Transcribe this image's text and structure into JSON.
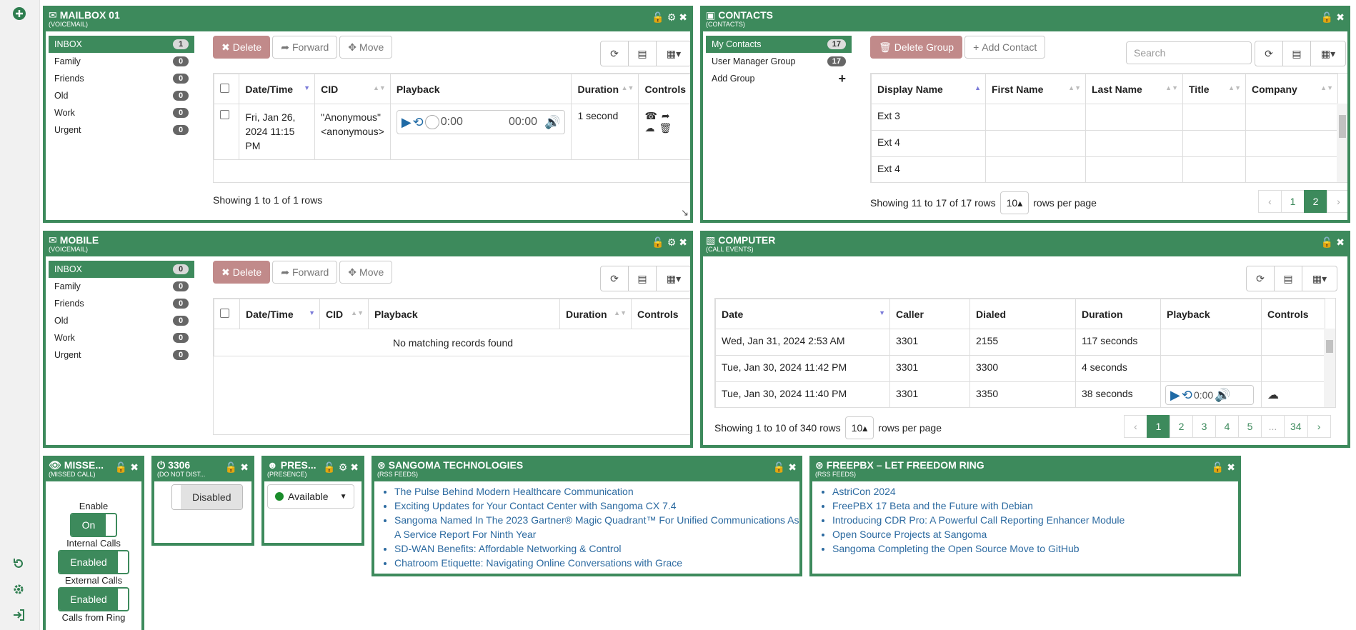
{
  "colors": {
    "accent": "#3d8a5c",
    "danger_btn": "#c18a8a",
    "link": "#2c6aa0"
  },
  "sidebar": {
    "top_icon": "plus-circle-icon",
    "bottom_icons": [
      "refresh-icon",
      "gear-icon",
      "sign-out-icon"
    ]
  },
  "mailbox": {
    "title": "MAILBOX 01",
    "subtitle": "(VOICEMAIL)",
    "folders": [
      {
        "label": "INBOX",
        "count": "1"
      },
      {
        "label": "Family",
        "count": "0"
      },
      {
        "label": "Friends",
        "count": "0"
      },
      {
        "label": "Old",
        "count": "0"
      },
      {
        "label": "Work",
        "count": "0"
      },
      {
        "label": "Urgent",
        "count": "0"
      }
    ],
    "buttons": {
      "delete": "Delete",
      "forward": "Forward",
      "move": "Move"
    },
    "columns": [
      "Date/Time",
      "CID",
      "Playback",
      "Duration",
      "Controls"
    ],
    "row": {
      "datetime": "Fri, Jan 26, 2024 11:15 PM",
      "cid_name": "\"Anonymous\"",
      "cid_num": "<anonymous>",
      "time_start": "0:00",
      "time_end": "00:00",
      "duration": "1 second"
    },
    "footer": "Showing 1 to 1 of 1 rows"
  },
  "mobile": {
    "title": "MOBILE",
    "subtitle": "(VOICEMAIL)",
    "folders": [
      {
        "label": "INBOX",
        "count": "0"
      },
      {
        "label": "Family",
        "count": "0"
      },
      {
        "label": "Friends",
        "count": "0"
      },
      {
        "label": "Old",
        "count": "0"
      },
      {
        "label": "Work",
        "count": "0"
      },
      {
        "label": "Urgent",
        "count": "0"
      }
    ],
    "buttons": {
      "delete": "Delete",
      "forward": "Forward",
      "move": "Move"
    },
    "columns": [
      "Date/Time",
      "CID",
      "Playback",
      "Duration",
      "Controls"
    ],
    "empty": "No matching records found"
  },
  "contacts": {
    "title": "CONTACTS",
    "subtitle": "(CONTACTS)",
    "groups": [
      {
        "label": "My Contacts",
        "count": "17"
      },
      {
        "label": "User Manager Group",
        "count": "17"
      }
    ],
    "add_group": "Add Group",
    "buttons": {
      "delete_group": "Delete Group",
      "add_contact": "Add Contact"
    },
    "search_placeholder": "Search",
    "columns": [
      "Display Name",
      "First Name",
      "Last Name",
      "Title",
      "Company"
    ],
    "rows": [
      "Ext 3",
      "Ext 4",
      "Ext 4"
    ],
    "footer": "Showing 11 to 17 of 17 rows",
    "rows_per_page": "10",
    "rows_per_page_label": "rows per page",
    "pages": [
      "‹",
      "1",
      "2",
      "›"
    ]
  },
  "computer": {
    "title": "COMPUTER",
    "subtitle": "(CALL EVENTS)",
    "columns": [
      "Date",
      "Caller",
      "Dialed",
      "Duration",
      "Playback",
      "Controls"
    ],
    "rows": [
      {
        "date": "Wed, Jan 31, 2024 2:53 AM",
        "caller": "3301",
        "dialed": "2155",
        "duration": "117 seconds"
      },
      {
        "date": "Tue, Jan 30, 2024 11:42 PM",
        "caller": "3301",
        "dialed": "3300",
        "duration": "4 seconds"
      },
      {
        "date": "Tue, Jan 30, 2024 11:40 PM",
        "caller": "3301",
        "dialed": "3350",
        "duration": "38 seconds",
        "time": "0:00"
      }
    ],
    "footer": "Showing 1 to 10 of 340 rows",
    "rows_per_page": "10",
    "rows_per_page_label": "rows per page",
    "pages": [
      "‹",
      "1",
      "2",
      "3",
      "4",
      "5",
      "...",
      "34",
      "›"
    ]
  },
  "missed": {
    "title": "MISSE...",
    "subtitle": "(MISSED CALL)",
    "enable_label": "Enable",
    "enable_value": "On",
    "internal_label": "Internal Calls",
    "internal_value": "Enabled",
    "external_label": "External Calls",
    "external_value": "Enabled",
    "ring_label": "Calls from Ring"
  },
  "dnd": {
    "title": "3306",
    "subtitle": "(DO NOT DIST...",
    "value": "Disabled"
  },
  "presence": {
    "title": "PRES...",
    "subtitle": "(PRESENCE)",
    "value": "Available"
  },
  "sangoma": {
    "title": "SANGOMA TECHNOLOGIES",
    "subtitle": "(RSS FEEDS)",
    "items": [
      "The Pulse Behind Modern Healthcare Communication",
      "Exciting Updates for Your Contact Center with Sangoma CX 7.4",
      "Sangoma Named In The 2023 Gartner® Magic Quadrant™ For Unified Communications As A Service Report For Ninth Year",
      "SD-WAN Benefits: Affordable Networking & Control",
      "Chatroom Etiquette: Navigating Online Conversations with Grace"
    ]
  },
  "freepbx": {
    "title": "FREEPBX – LET FREEDOM RING",
    "subtitle": "(RSS FEEDS)",
    "items": [
      "AstriCon 2024",
      "FreePBX 17 Beta and the Future with Debian",
      "Introducing CDR Pro: A Powerful Call Reporting Enhancer Module",
      "Open Source Projects at Sangoma",
      "Sangoma Completing the Open Source Move to GitHub"
    ]
  }
}
